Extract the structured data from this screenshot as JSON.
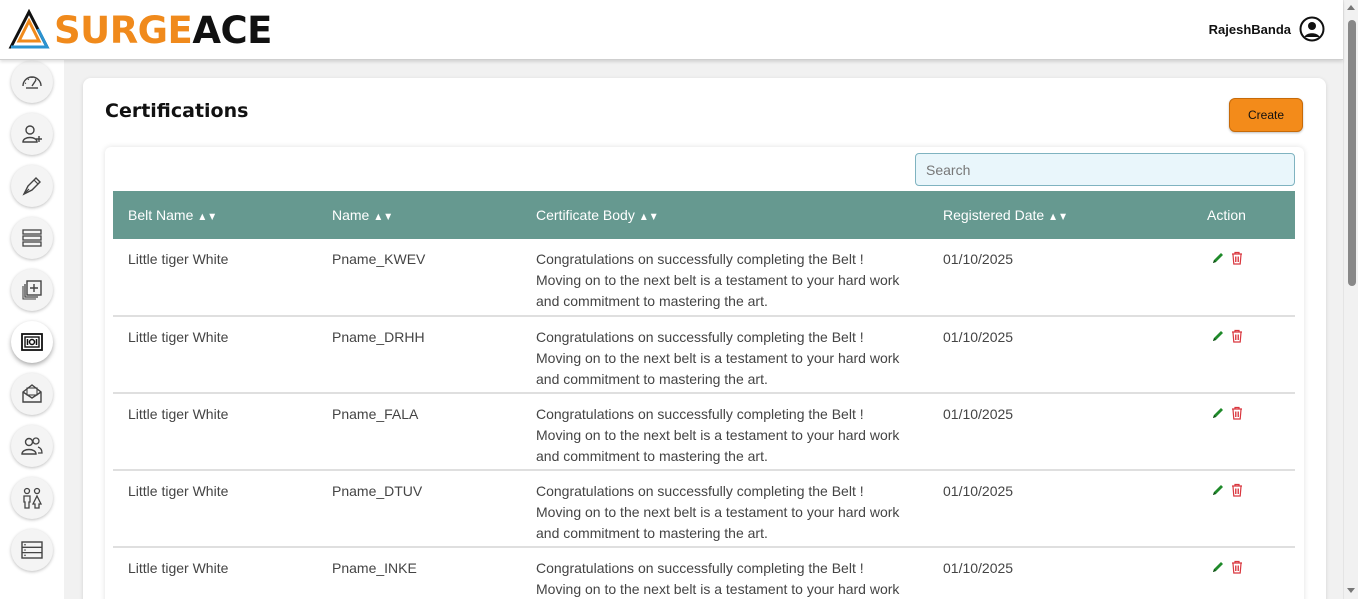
{
  "header": {
    "logo_part1": "SURGE",
    "logo_part2": "ACE",
    "username": "RajeshBanda"
  },
  "sidebar": {
    "items": [
      {
        "icon": "dashboard-gauge-icon"
      },
      {
        "icon": "add-user-icon"
      },
      {
        "icon": "pen-tool-icon"
      },
      {
        "icon": "list-rows-icon"
      },
      {
        "icon": "add-stack-icon"
      },
      {
        "icon": "certificate-icon",
        "active": true
      },
      {
        "icon": "mail-open-icon"
      },
      {
        "icon": "users-group-icon"
      },
      {
        "icon": "family-icon"
      },
      {
        "icon": "server-list-icon"
      }
    ]
  },
  "page": {
    "title": "Certifications",
    "create_label": "Create",
    "search_placeholder": "Search"
  },
  "table": {
    "columns": [
      "Belt Name",
      "Name",
      "Certificate Body",
      "Registered Date",
      "Action"
    ],
    "rows": [
      {
        "belt": "Little tiger White",
        "name": "Pname_KWEV",
        "body": "Congratulations on successfully completing the Belt ! Moving on to the next belt is a testament to your hard work and commitment to mastering the art.",
        "date": "01/10/2025"
      },
      {
        "belt": "Little tiger White",
        "name": "Pname_DRHH",
        "body": "Congratulations on successfully completing the Belt ! Moving on to the next belt is a testament to your hard work and commitment to mastering the art.",
        "date": "01/10/2025"
      },
      {
        "belt": "Little tiger White",
        "name": "Pname_FALA",
        "body": "Congratulations on successfully completing the Belt ! Moving on to the next belt is a testament to your hard work and commitment to mastering the art.",
        "date": "01/10/2025"
      },
      {
        "belt": "Little tiger White",
        "name": "Pname_DTUV",
        "body": "Congratulations on successfully completing the Belt ! Moving on to the next belt is a testament to your hard work and commitment to mastering the art.",
        "date": "01/10/2025"
      },
      {
        "belt": "Little tiger White",
        "name": "Pname_INKE",
        "body": "Congratulations on successfully completing the Belt ! Moving on to the next belt is a testament to your hard work and commitment to mastering the art.",
        "date": "01/10/2025"
      }
    ]
  },
  "colors": {
    "brand_orange": "#f08a1c",
    "header_teal": "#669990",
    "edit_green": "#1f8a2a",
    "delete_red": "#d9363e"
  }
}
